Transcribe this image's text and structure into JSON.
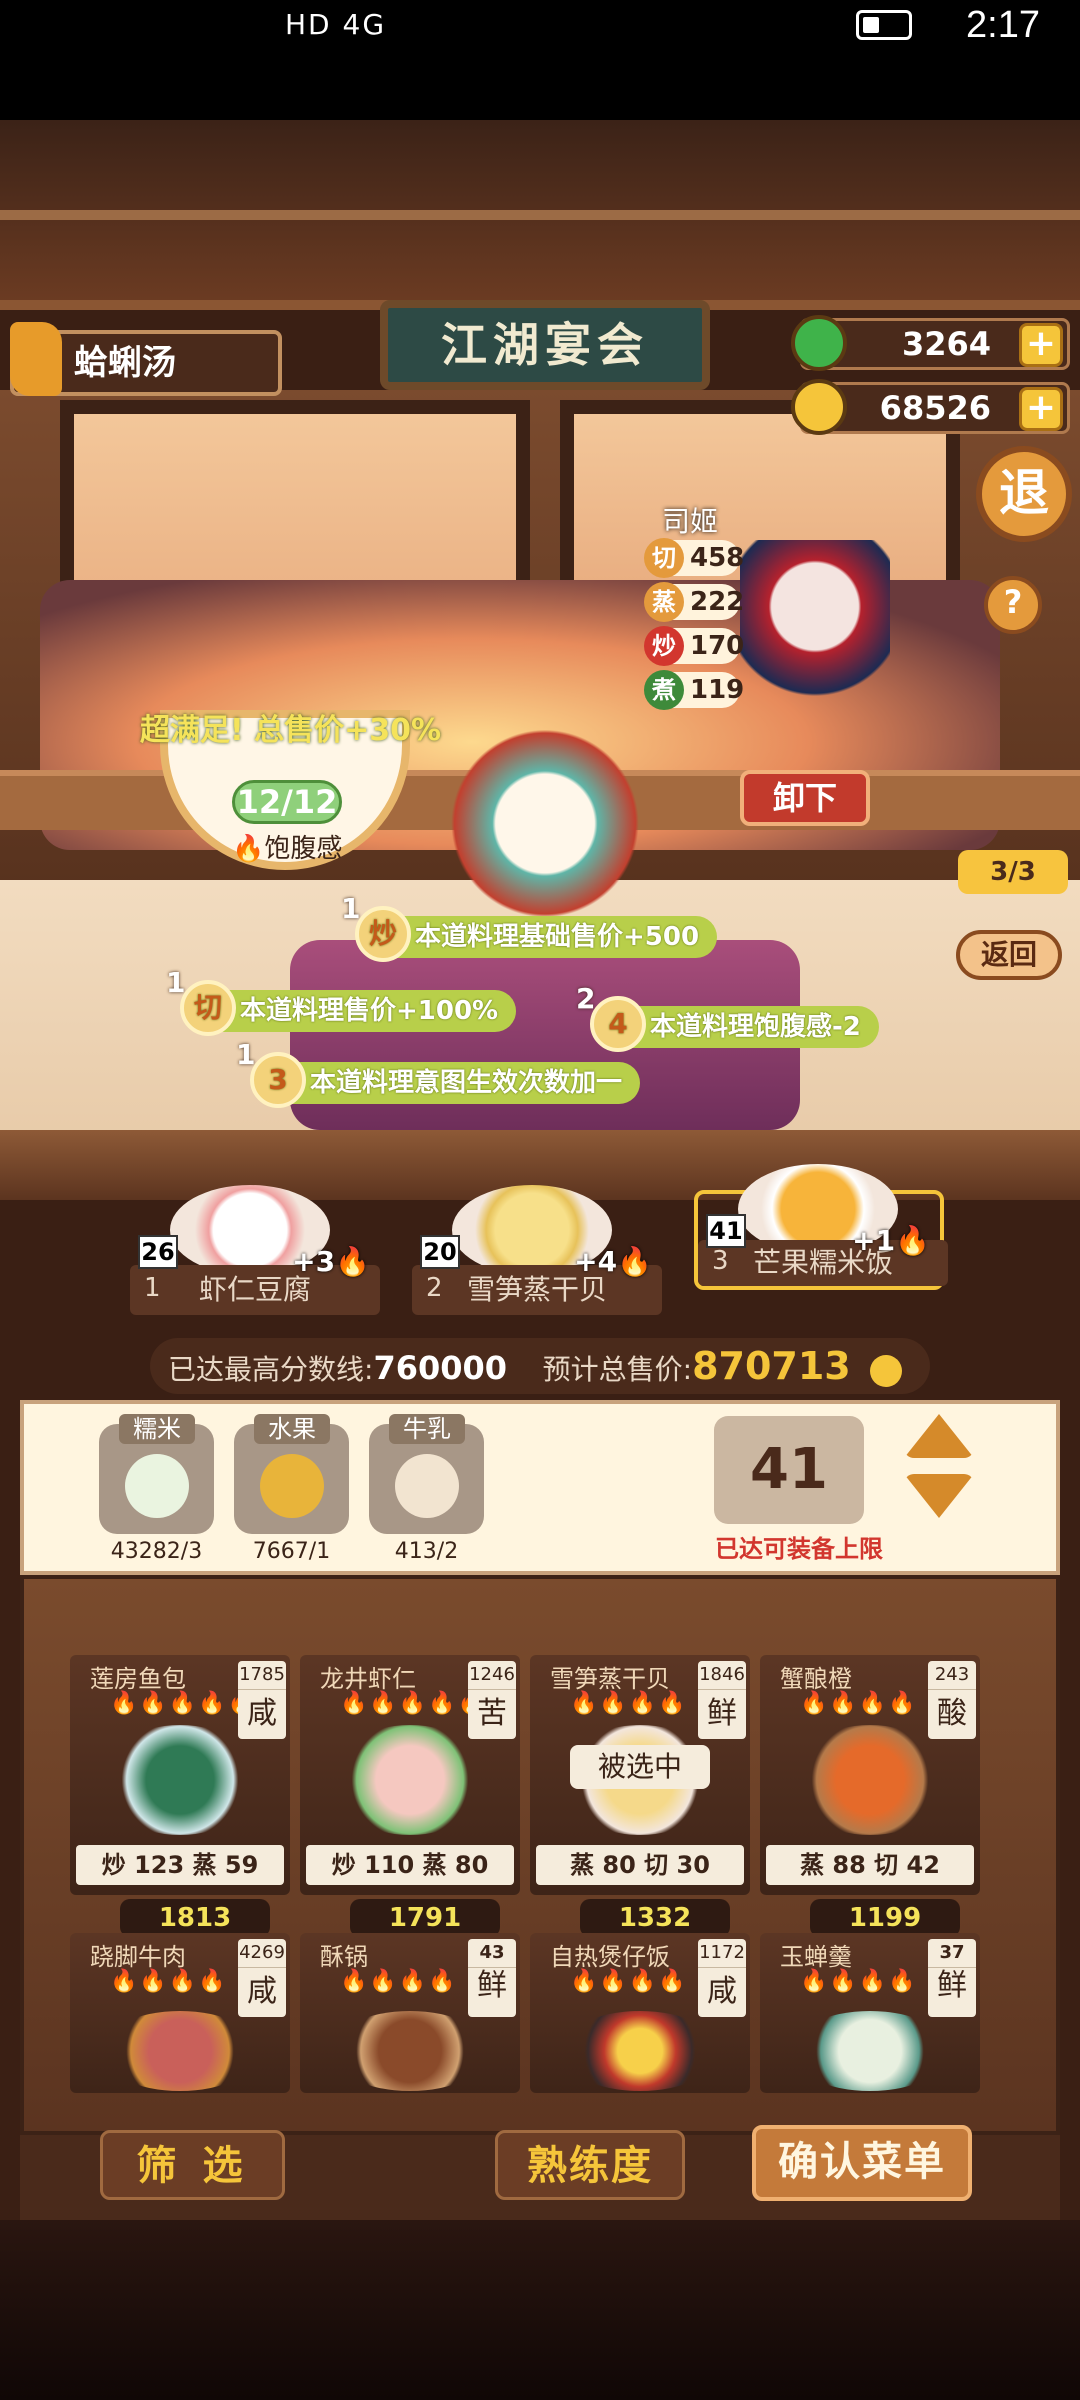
{
  "status_bar": {
    "left": "HD 4G",
    "time": "2:17"
  },
  "header": {
    "dish_name": "蛤蜊汤",
    "sign_text": "江湖宴会",
    "jade": "3264",
    "coins": "68526",
    "exit_label": "退",
    "help_label": "?"
  },
  "chef": {
    "name": "司姬",
    "stats": [
      {
        "icon": "切",
        "value": "458"
      },
      {
        "icon": "蒸",
        "value": "222"
      },
      {
        "icon": "炒",
        "value": "170"
      },
      {
        "icon": "煮",
        "value": "119"
      }
    ],
    "unload_label": "卸下"
  },
  "bubble": {
    "text": "超满足! 总售价+30%",
    "count": "12/12",
    "label": "饱腹感"
  },
  "buffs": [
    {
      "num": "1",
      "icon": "炒",
      "text": "本道料理基础售价+500"
    },
    {
      "num": "1",
      "icon": "切",
      "text": "本道料理售价+100%"
    },
    {
      "num": "2",
      "icon": "4",
      "text": "本道料理饱腹感-2"
    },
    {
      "num": "1",
      "icon": "3",
      "text": "本道料理意图生效次数加一"
    }
  ],
  "slots": {
    "count": "3/3",
    "back_label": "返回"
  },
  "shelf": [
    {
      "level": "26",
      "bonus": "+3",
      "index": "1",
      "name": "虾仁豆腐"
    },
    {
      "level": "20",
      "bonus": "+4",
      "index": "2",
      "name": "雪笋蒸干贝"
    },
    {
      "level": "41",
      "bonus": "+1",
      "index": "3",
      "name": "芒果糯米饭"
    }
  ],
  "summary": {
    "high_label": "已达最高分数线:",
    "high_value": "760000",
    "total_label": "预计总售价:",
    "total_value": "870713"
  },
  "ingredients": [
    {
      "label": "糯米",
      "count": "43282/3"
    },
    {
      "label": "水果",
      "count": "7667/1"
    },
    {
      "label": "牛乳",
      "count": "413/2"
    }
  ],
  "quantity": {
    "value": "41",
    "limit_text": "已达可装备上限"
  },
  "recipes": [
    {
      "name": "莲房鱼包",
      "num": "1785",
      "taste": "咸",
      "flames": "🔥🔥🔥🔥🔥",
      "stats": "炒 123  蒸 59",
      "price": "1813"
    },
    {
      "name": "龙井虾仁",
      "num": "1246",
      "taste": "苦",
      "flames": "🔥🔥🔥🔥🔥",
      "stats": "炒 110  蒸 80",
      "price": "1791"
    },
    {
      "name": "雪笋蒸干贝",
      "num": "1846",
      "taste": "鲜",
      "flames": "🔥🔥🔥🔥",
      "stats": "蒸 80  切 30",
      "price": "1332",
      "selected": "被选中"
    },
    {
      "name": "蟹酿橙",
      "num": "243",
      "taste": "酸",
      "flames": "🔥🔥🔥🔥",
      "stats": "蒸 88  切 42",
      "price": "1199"
    },
    {
      "name": "跷脚牛肉",
      "num": "4269",
      "taste": "咸",
      "flames": "🔥🔥🔥🔥"
    },
    {
      "name": "酥锅",
      "num": "43",
      "taste": "鲜",
      "flames": "🔥🔥🔥🔥"
    },
    {
      "name": "自热煲仔饭",
      "num": "1172",
      "taste": "咸",
      "flames": "🔥🔥🔥🔥"
    },
    {
      "name": "玉蝉羹",
      "num": "37",
      "taste": "鲜",
      "flames": "🔥🔥🔥🔥"
    }
  ],
  "bottom_buttons": {
    "filter": "筛 选",
    "proficiency": "熟练度",
    "confirm": "确认菜单"
  }
}
